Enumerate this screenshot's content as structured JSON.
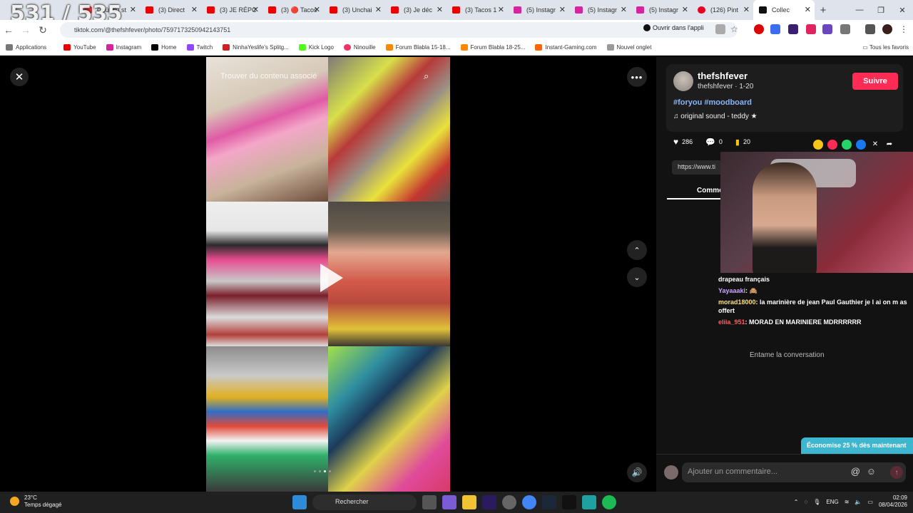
{
  "overlay_counter": "531 / 535",
  "browser": {
    "tabs": [
      {
        "label": "Coût du st",
        "color": "#d33"
      },
      {
        "label": "(3) Direct",
        "color": "#e00"
      },
      {
        "label": "(3) JE RÉPC",
        "color": "#e00"
      },
      {
        "label": "(3) 🔴 Tacos",
        "color": "#e00"
      },
      {
        "label": "(3) Unchai",
        "color": "#e00"
      },
      {
        "label": "(3) Je déc",
        "color": "#e00"
      },
      {
        "label": "(3) Tacos 1",
        "color": "#e00"
      },
      {
        "label": "(5) Instagr",
        "color": "#d6249f"
      },
      {
        "label": "(5) Instagr",
        "color": "#d6249f"
      },
      {
        "label": "(5) Instagr",
        "color": "#d6249f"
      },
      {
        "label": "(126) Pint",
        "color": "#e60023"
      },
      {
        "label": "Collec",
        "color": "#111"
      }
    ],
    "url": "tiktok.com/@thefshfever/photo/7597173250942143751",
    "open_app_label": "Ouvrir dans l'appli",
    "bookmarks": [
      {
        "label": "Applications",
        "color": "#777"
      },
      {
        "label": "YouTube",
        "color": "#e00"
      },
      {
        "label": "Instagram",
        "color": "#d6249f"
      },
      {
        "label": "Home",
        "color": "#000"
      },
      {
        "label": "Twitch",
        "color": "#9146ff"
      },
      {
        "label": "NinhaYeslife's Splitg...",
        "color": "#c22"
      },
      {
        "label": "Kick Logo",
        "color": "#53fc18"
      },
      {
        "label": "Ninouille",
        "color": "#e36"
      },
      {
        "label": "Forum Blabla 15-18...",
        "color": "#ff8800"
      },
      {
        "label": "Forum Blabla 18-25...",
        "color": "#ff8800"
      },
      {
        "label": "Instant-Gaming.com",
        "color": "#f60"
      },
      {
        "label": "Nouvel onglet",
        "color": "#999"
      }
    ],
    "bookmarks_all": "Tous les favoris"
  },
  "viewer": {
    "search_overlay": "Trouver du contenu associé"
  },
  "post": {
    "username": "thefshfever",
    "subline": "thefshfever · 1-20",
    "follow_label": "Suivre",
    "hashtags": "#foryou #moodboard",
    "sound": "original sound - teddy ★",
    "likes": "286",
    "comments": "0",
    "saves": "20",
    "link_prefix": "https://www.ti",
    "comments_tab": "Comme"
  },
  "chat": [
    {
      "name": "",
      "text": "drapeau français"
    },
    {
      "name": "Yayaaaki",
      "text": ": 🙈"
    },
    {
      "name": "morad18000",
      "text": ": la marinière de jean Paul Gauthier je l ai on m as offert"
    },
    {
      "name": "eliia_951",
      "text": ": MORAD EN MARINIERE MDRRRRRR"
    }
  ],
  "empty_comments": "Entame la conversation",
  "promo": "Économise 25 % dès maintenant",
  "comment_placeholder": "Ajouter un commentaire...",
  "taskbar": {
    "temp": "23°C",
    "weather": "Temps dégagé",
    "search": "Rechercher",
    "lang": "ENG",
    "time": "02:09",
    "date": "08/04/2026"
  },
  "colors": {
    "accent": "#fe2c55",
    "hashtag": "#8ab4f8",
    "promo": "#3fb6cf"
  }
}
